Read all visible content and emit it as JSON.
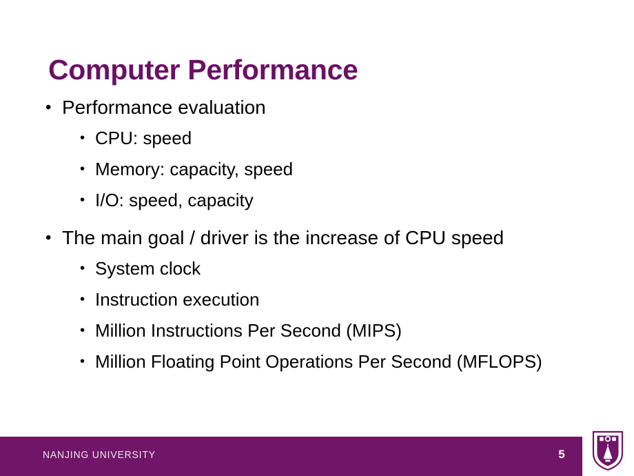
{
  "slide": {
    "title": "Computer Performance",
    "page_number": "5",
    "organization": "NANJING UNIVERSITY",
    "bullet_glyph": "•",
    "colors": {
      "title_purple": "#6B1164",
      "footer_purple": "#701567",
      "body_text": "#000000",
      "footer_text": "#EFE4EE",
      "page_number_text": "#FFFFFF",
      "background": "#FFFFFF"
    },
    "content": [
      {
        "level": 1,
        "text": "Performance evaluation"
      },
      {
        "level": 2,
        "text": "CPU: speed"
      },
      {
        "level": 2,
        "text": "Memory: capacity, speed"
      },
      {
        "level": 2,
        "text": "I/O: speed, capacity"
      },
      {
        "level": 1,
        "text": "The main goal / driver is the increase of CPU speed"
      },
      {
        "level": 2,
        "text": "System clock"
      },
      {
        "level": 2,
        "text": "Instruction execution"
      },
      {
        "level": 2,
        "text": "Million Instructions Per Second (MIPS)"
      },
      {
        "level": 2,
        "text": "Million Floating Point Operations Per Second (MFLOPS)"
      }
    ],
    "logo": {
      "name": "nanjing-university-crest",
      "shape": "shield"
    }
  }
}
